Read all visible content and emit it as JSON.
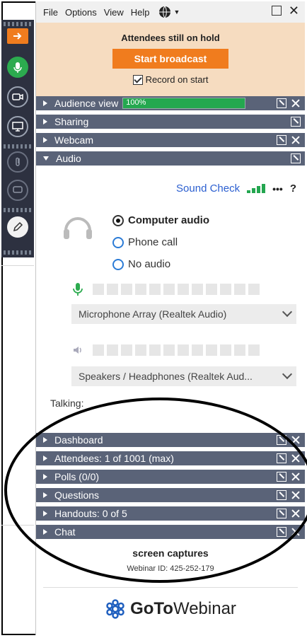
{
  "menu": {
    "items": [
      "File",
      "Options",
      "View",
      "Help"
    ]
  },
  "hold": {
    "status": "Attendees still on hold",
    "start_label": "Start broadcast",
    "record_label": "Record on start"
  },
  "panes": {
    "audience": {
      "label": "Audience view",
      "percent_text": "100%",
      "percent": 100
    },
    "sharing": {
      "label": "Sharing"
    },
    "webcam": {
      "label": "Webcam"
    },
    "audio": {
      "label": "Audio"
    }
  },
  "audio": {
    "soundcheck": "Sound Check",
    "more": "•••",
    "help": "?",
    "options": [
      "Computer audio",
      "Phone call",
      "No audio"
    ],
    "selected_option": "Computer audio",
    "mic_device": "Microphone Array (Realtek Audio)",
    "speaker_device": "Speakers / Headphones (Realtek Aud...",
    "talking_label": "Talking:"
  },
  "collapsed": {
    "dashboard": "Dashboard",
    "attendees": "Attendees:  1 of 1001 (max)",
    "polls": "Polls (0/0)",
    "questions": "Questions",
    "handouts": "Handouts: 0 of 5",
    "chat": "Chat"
  },
  "footer": {
    "title": "screen captures",
    "webinar_id": "Webinar ID: 425-252-179"
  },
  "logo": {
    "part1": "GoTo",
    "part2": "Webinar"
  },
  "colors": {
    "accent": "#f07c1e",
    "bar": "#5a6378",
    "toolbar": "#2d3140",
    "progress": "#24a84f",
    "link": "#2b5fd0",
    "hold_bg": "#f6dcc0"
  },
  "icons": [
    "arrow-right-icon",
    "microphone-icon",
    "webcam-icon",
    "screen-share-icon",
    "handout-icon",
    "chat-bubble-icon",
    "pen-icon",
    "globe-icon",
    "headset-icon",
    "speaker-icon",
    "signal-icon",
    "gotowebinar-logo-icon"
  ]
}
